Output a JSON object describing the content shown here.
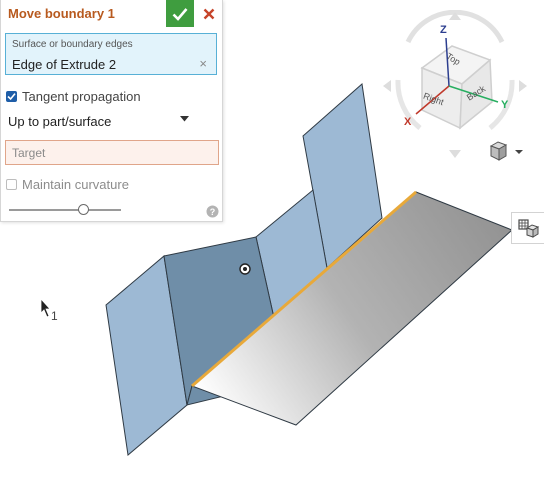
{
  "dialog": {
    "title": "Move boundary 1",
    "selection_label": "Surface or boundary edges",
    "selection_item": "Edge of Extrude 2",
    "tangent_propagation_label": "Tangent propagation",
    "tangent_propagation_checked": true,
    "end_type": "Up to part/surface",
    "target_placeholder": "Target",
    "maintain_curvature_label": "Maintain curvature",
    "maintain_curvature_checked": false,
    "slider_position": 0.68
  },
  "view_cube": {
    "axis_z": "Z",
    "axis_x": "X",
    "axis_y": "Y",
    "face_top": "Top",
    "face_right": "Right",
    "face_back": "Back"
  },
  "cursor": {
    "index_label": "1"
  },
  "colors": {
    "accent_title": "#b85a1f",
    "accept_green": "#3f9d3f",
    "cancel_red": "#c6442a",
    "selection_bg": "#e2f3fb",
    "target_border": "#e0a58a",
    "surface_blue": "#9db9d4",
    "selected_face": "#6f8ea8",
    "edge_highlight": "#e8a93a",
    "axis_x": "#c0392b",
    "axis_y": "#27ae60",
    "axis_z": "#2c3e8f"
  },
  "icons": [
    "check-icon",
    "close-icon",
    "chevron-down-icon",
    "help-icon",
    "view-cube",
    "display-mode-icon",
    "view-tools-icon",
    "mouse-pointer-icon"
  ]
}
